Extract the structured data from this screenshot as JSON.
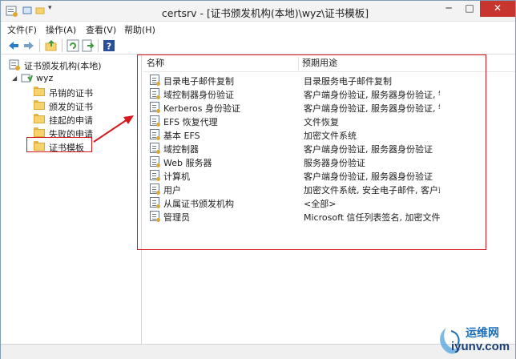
{
  "window": {
    "title": "certsrv - [证书颁发机构(本地)\\wyz\\证书模板]",
    "minimize": "─",
    "maximize": "□",
    "close": "✕"
  },
  "menu": {
    "items": [
      {
        "label": "文件(F)"
      },
      {
        "label": "操作(A)"
      },
      {
        "label": "查看(V)"
      },
      {
        "label": "帮助(H)"
      }
    ]
  },
  "toolbar": {
    "buttons": [
      "back-arrow-icon",
      "forward-arrow-icon",
      "up-folder-icon",
      "refresh-icon",
      "export-icon",
      "help-icon"
    ]
  },
  "tree": {
    "root": "证书颁发机构(本地)",
    "ca": "wyz",
    "children": [
      {
        "label": "吊销的证书"
      },
      {
        "label": "颁发的证书"
      },
      {
        "label": "挂起的申请"
      },
      {
        "label": "失败的申请"
      },
      {
        "label": "证书模板"
      }
    ]
  },
  "list": {
    "columns": {
      "name": "名称",
      "purpose": "预期用途"
    },
    "rows": [
      {
        "name": "目录电子邮件复制",
        "purpose": "目录服务电子邮件复制"
      },
      {
        "name": "域控制器身份验证",
        "purpose": "客户端身份验证, 服务器身份验证, 智能..."
      },
      {
        "name": "Kerberos 身份验证",
        "purpose": "客户端身份验证, 服务器身份验证, 智能..."
      },
      {
        "name": "EFS 恢复代理",
        "purpose": "文件恢复"
      },
      {
        "name": "基本 EFS",
        "purpose": "加密文件系统"
      },
      {
        "name": "域控制器",
        "purpose": "客户端身份验证, 服务器身份验证"
      },
      {
        "name": "Web 服务器",
        "purpose": "服务器身份验证"
      },
      {
        "name": "计算机",
        "purpose": "客户端身份验证, 服务器身份验证"
      },
      {
        "name": "用户",
        "purpose": "加密文件系统, 安全电子邮件, 客户端身..."
      },
      {
        "name": "从属证书颁发机构",
        "purpose": "<全部>"
      },
      {
        "name": "管理员",
        "purpose": "Microsoft 信任列表签名, 加密文件系..."
      }
    ]
  },
  "watermark": {
    "line1": "运维网",
    "line2": "iyunv.com"
  },
  "colors": {
    "annotation": "#d6171c",
    "close_button": "#c7352e",
    "folder": "#f7d36e"
  }
}
